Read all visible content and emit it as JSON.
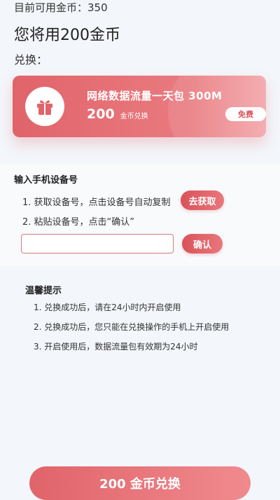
{
  "balance": {
    "text": "目前可用金币：350"
  },
  "headline": {
    "text": "您将用200金币"
  },
  "exchange_label": "兑换：",
  "product_card": {
    "title": "网络数据流量一天包 300M",
    "price": "200",
    "price_unit": "金币兑换",
    "badge": "免费",
    "icon": "gift-icon",
    "accent_color": "#e0646a"
  },
  "device_section": {
    "title": "输入手机设备号",
    "step1": "1. 获取设备号，点击设备号自动复制",
    "get_button": "去获取",
    "step2": "2. 粘贴设备号，点击“确认”",
    "input_value": "",
    "input_placeholder": "",
    "confirm_button": "确认"
  },
  "tips": {
    "title": "温馨提示",
    "items": [
      "1. 兑换成功后，请在24小时内开启使用",
      "2. 兑换成功后，您只能在兑换操作的手机上开启使用",
      "3. 开启使用后，数据流量包有效期为24小时"
    ]
  },
  "redeem_button": "200 金币兑换"
}
